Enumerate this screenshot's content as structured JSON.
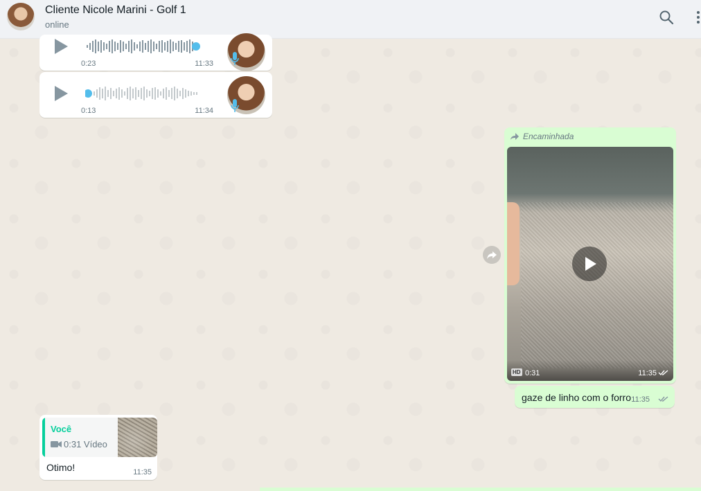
{
  "header": {
    "contact_name": "Cliente Nicole Marini - Golf 1",
    "status": "online",
    "icons": [
      "search-icon",
      "menu-icon"
    ]
  },
  "messages": {
    "audio1": {
      "duration": "0:23",
      "time": "11:33"
    },
    "audio2": {
      "duration": "0:13",
      "time": "11:34"
    },
    "forwarded_video": {
      "forwarded_label": "Encaminhada",
      "hd_badge": "HD",
      "duration": "0:31",
      "time": "11:35"
    },
    "caption": {
      "text": "gaze de linho com o forro",
      "time": "11:35"
    },
    "reply": {
      "quoted_author": "Você",
      "quoted_desc": "0:31 Vídeo",
      "text": "Otimo!",
      "time": "11:35"
    }
  },
  "colors": {
    "chat_bg": "#efeae2",
    "outgoing_bubble": "#d9fdd3",
    "incoming_bubble": "#ffffff",
    "accent_green": "#06cf9c",
    "audio_blue": "#53bdeb"
  }
}
